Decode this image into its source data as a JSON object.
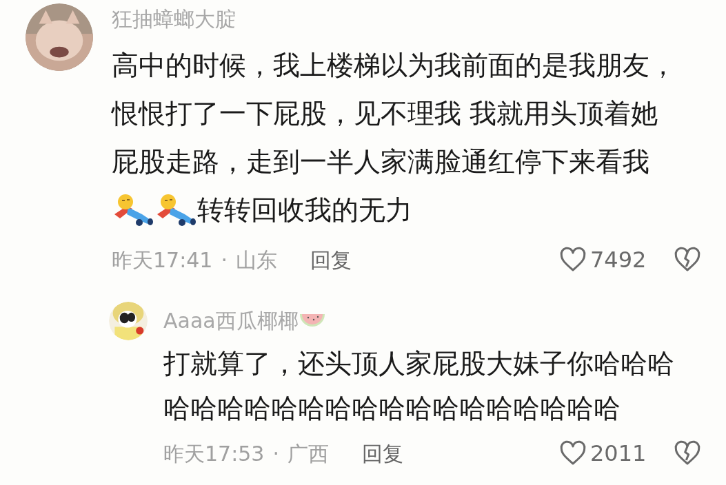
{
  "comment": {
    "author": "狂抽蟑螂大腚",
    "lines": [
      "高中的时候，我上楼梯以为我前面的是我朋友，",
      "恨恨打了一下屁股，见不理我 我就用头顶着她",
      "屁股走路，走到一半人家满脸通红停下来看我"
    ],
    "last_line": {
      "stickers": [
        {
          "kind": "lying-figure"
        },
        {
          "kind": "lying-figure"
        }
      ],
      "text": "转转回收我的无力"
    },
    "time": "昨天17:41",
    "separator": "·",
    "location": "山东",
    "reply_label": "回复",
    "likes": "7492",
    "reply": {
      "author": "Aaaa西瓜椰椰",
      "author_emoji": {
        "kind": "watermelon"
      },
      "lines": [
        "打就算了，还头顶人家屁股大妹子你哈哈哈",
        "哈哈哈哈哈哈哈哈哈哈哈哈哈哈哈哈哈"
      ],
      "time": "昨天17:53",
      "separator": "·",
      "location": "广西",
      "reply_label": "回复",
      "likes": "2011"
    }
  }
}
